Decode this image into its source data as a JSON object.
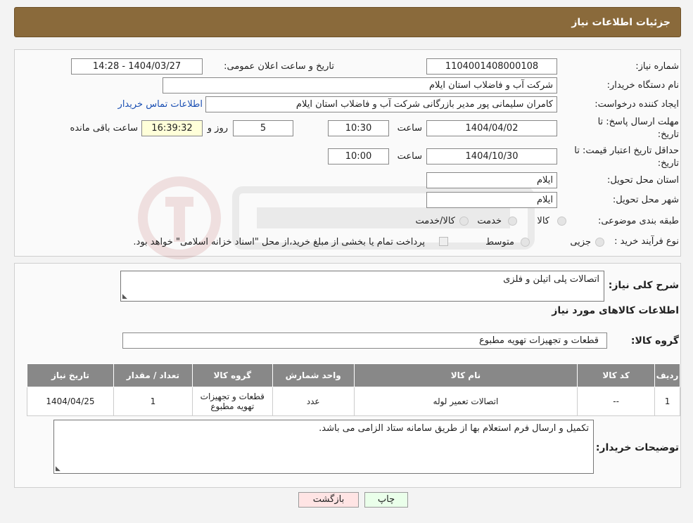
{
  "header": {
    "title": "جزئیات اطلاعات نیاز"
  },
  "form": {
    "need_number_label": "شماره نیاز:",
    "need_number": "1104001408000108",
    "announce_label": "تاریخ و ساعت اعلان عمومی:",
    "announce_value": "1404/03/27 - 14:28",
    "buyer_org_label": "نام دستگاه خریدار:",
    "buyer_org": "شرکت آب و فاضلاب استان ایلام",
    "requester_label": "ایجاد کننده درخواست:",
    "requester": "کامران سلیمانی پور مدیر بازرگانی شرکت آب و فاضلاب استان ایلام",
    "contact_link": "اطلاعات تماس خریدار",
    "deadline_label_1": "مهلت ارسال پاسخ: تا",
    "deadline_label_2": "تاریخ:",
    "deadline_date": "1404/04/02",
    "time_label": "ساعت",
    "deadline_time": "10:30",
    "days": "5",
    "days_label": "روز و",
    "remaining_time": "16:39:32",
    "remaining_label": "ساعت باقی مانده",
    "price_validity_label_1": "حداقل تاریخ اعتبار قیمت: تا",
    "price_validity_label_2": "تاریخ:",
    "price_validity_date": "1404/10/30",
    "price_validity_time_label": "ساعت",
    "price_validity_time": "10:00",
    "province_label": "استان محل تحویل:",
    "province": "ایلام",
    "city_label": "شهر محل تحویل:",
    "city": "ایلام",
    "category_label": "طبقه بندی موضوعی:",
    "category_options": [
      "کالا",
      "خدمت",
      "کالا/خدمت"
    ],
    "process_label": "نوع فرآیند خرید :",
    "process_options": [
      "جزیی",
      "متوسط"
    ],
    "process_note": "پرداخت تمام یا بخشی از مبلغ خرید،از محل \"اسناد خزانه اسلامی\" خواهد بود."
  },
  "details": {
    "description_label": "شرح کلی نیاز:",
    "description": "اتصالات پلی اتیلن و فلزی",
    "goods_info_title": "اطلاعات کالاهای مورد نیاز",
    "goods_group_label": "گروه کالا:",
    "goods_group": "قطعات و تجهیزات تهویه مطبوع",
    "table": {
      "headers": [
        "ردیف",
        "کد کالا",
        "نام کالا",
        "واحد شمارش",
        "گروه کالا",
        "تعداد / مقدار",
        "تاریخ نیاز"
      ],
      "rows": [
        [
          "1",
          "--",
          "اتصالات تعمیر لوله",
          "عدد",
          "قطعات و تجهیزات تهویه مطبوع",
          "1",
          "1404/04/25"
        ]
      ]
    },
    "buyer_notes_label": "توضیحات خریدار:",
    "buyer_notes": "تکمیل و ارسال فرم استعلام بها از طریق سامانه ستاد الزامی می باشد."
  },
  "buttons": {
    "print": "چاپ",
    "back": "بازگشت"
  },
  "colors": {
    "header_bg": "#8a6a3b",
    "print_bg": "#eaffea",
    "back_bg": "#ffe4e4",
    "link": "#1a4fb3"
  }
}
